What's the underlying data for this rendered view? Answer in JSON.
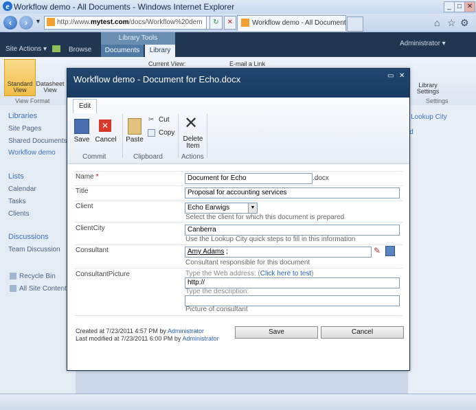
{
  "browser": {
    "title": "Workflow demo - All Documents - Windows Internet Explorer",
    "address_domain": "mytest.com",
    "address_prefix": "http://www.",
    "address_suffix": "/docs/Workflow%20dem",
    "tab_label": "Workflow demo - All Documents",
    "tab_close": "✖"
  },
  "sharepoint": {
    "site_actions": "Site Actions ▾",
    "browse": "Browse",
    "library_tools": "Library Tools",
    "tab_documents": "Documents",
    "tab_library": "Library",
    "admin": "Administrator ▾",
    "ribbon_current_view": "Current View:",
    "ribbon_email_link": "E-mail a Link",
    "ribbon_standard_view": "Standard View",
    "ribbon_datasheet_view": "Datasheet View",
    "ribbon_view_format": "View Format",
    "ribbon_library_settings": "Library Settings",
    "ribbon_settings": "Settings",
    "right_lookup_city": "Lookup City",
    "right_partial": "ld",
    "nav": {
      "libraries": "Libraries",
      "site_pages": "Site Pages",
      "shared_documents": "Shared Documents",
      "workflow_demo": "Workflow demo",
      "lists": "Lists",
      "calendar": "Calendar",
      "tasks": "Tasks",
      "clients": "Clients",
      "discussions": "Discussions",
      "team_discussion": "Team Discussion",
      "recycle_bin": "Recycle Bin",
      "all_site_content": "All Site Content"
    }
  },
  "dialog": {
    "title": "Workflow demo - Document for Echo.docx",
    "tab_edit": "Edit",
    "save": "Save",
    "cancel": "Cancel",
    "paste": "Paste",
    "cut": "Cut",
    "copy": "Copy",
    "delete_item": "Delete Item",
    "group_commit": "Commit",
    "group_clipboard": "Clipboard",
    "group_actions": "Actions",
    "fields": {
      "name_label": "Name",
      "required_mark": "*",
      "name_value": "Document for Echo",
      "name_ext": ".docx",
      "title_label": "Title",
      "title_value": "Proposal for accounting services",
      "client_label": "Client",
      "client_value": "Echo Earwigs",
      "client_desc": "Select the client for which this document is prepared",
      "clientcity_label": "ClientCity",
      "clientcity_value": "Canberra",
      "clientcity_desc": "Use the Lookup City quick steps to fill in this information",
      "consultant_label": "Consultant",
      "consultant_value": "Amy Adams",
      "consultant_sep": ";",
      "consultant_desc": "Consultant responsible for this document",
      "picture_label": "ConsultantPicture",
      "picture_web_prompt": "Type the Web address: (",
      "picture_test_link": "Click here to test",
      "picture_web_close": ")",
      "picture_url_value": "http://",
      "picture_desc_prompt": "Type the description:",
      "picture_desc_value": "",
      "picture_desc": "Picture of consultant"
    },
    "footer": {
      "created_prefix": "Created at 7/23/2011 4:57 PM by ",
      "created_by": "Administrator",
      "modified_prefix": "Last modified at 7/23/2011 6:00 PM by ",
      "modified_by": "Administrator"
    },
    "save_button": "Save",
    "cancel_button": "Cancel"
  }
}
